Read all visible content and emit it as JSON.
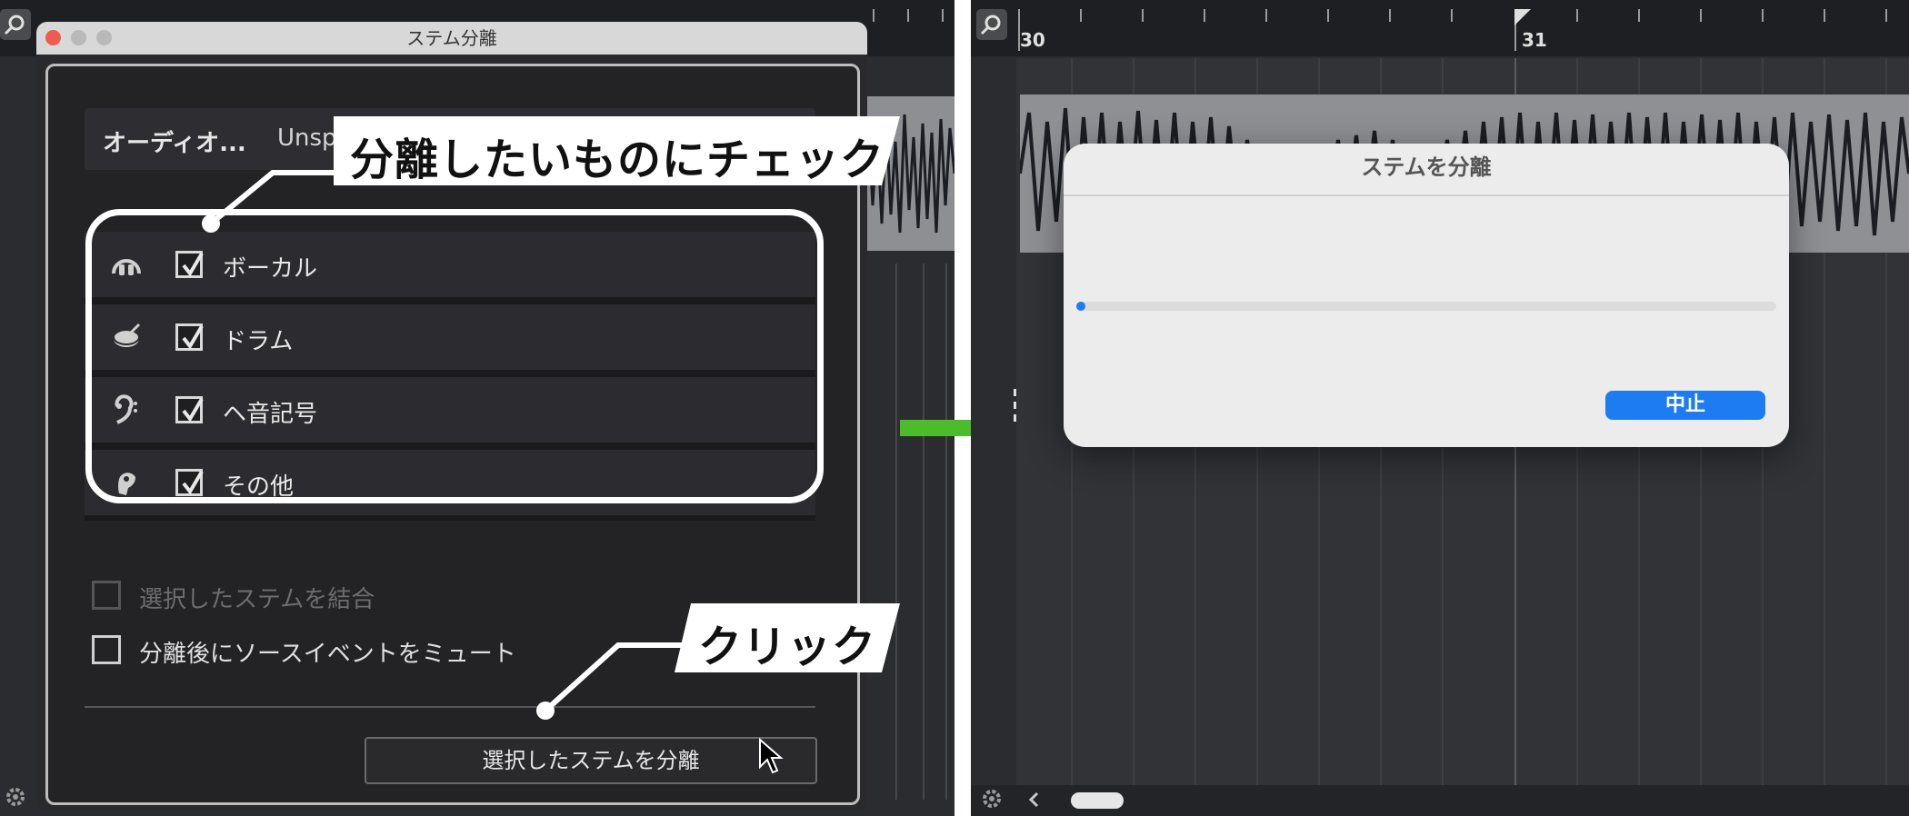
{
  "left": {
    "dialog_title": "ステム分離",
    "audio_label": "オーディオ...",
    "audio_value": "Unsp",
    "stems": [
      {
        "icon": "microphone-icon",
        "label": "ボーカル",
        "checked": true
      },
      {
        "icon": "drum-icon",
        "label": "ドラム",
        "checked": true
      },
      {
        "icon": "bass-clef-icon",
        "label": "ヘ音記号",
        "checked": true
      },
      {
        "icon": "ear-icon",
        "label": "その他",
        "checked": true
      }
    ],
    "combine_label": "選択したステムを結合",
    "mute_label": "分離後にソースイベントをミュート",
    "separate_button": "選択したステムを分離",
    "callout_check": "分離したいものにチェック",
    "callout_click": "クリック"
  },
  "right": {
    "ruler_marks": [
      "30",
      "31"
    ],
    "modal_title": "ステムを分離",
    "progress": 0.01,
    "stop_button": "中止"
  },
  "colors": {
    "accent_blue": "#1d7cf2",
    "arrow_green": "#4cbb2c",
    "close_red": "#ee5b4f",
    "background_dark": "#2b2c2f"
  }
}
